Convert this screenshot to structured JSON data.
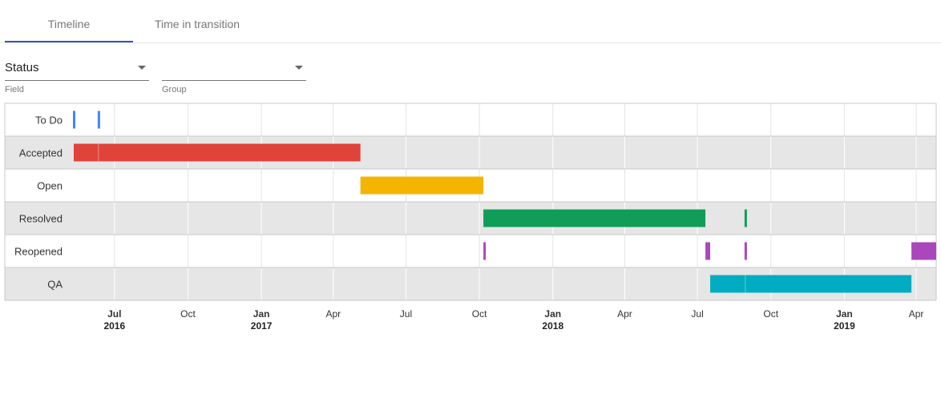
{
  "tabs": [
    {
      "label": "Timeline",
      "active": true
    },
    {
      "label": "Time in transition",
      "active": false
    }
  ],
  "filters": {
    "field": {
      "value": "Status",
      "label": "Field"
    },
    "group": {
      "value": "",
      "label": "Group"
    }
  },
  "colors": {
    "accent": "#3f51b5",
    "row_alt": "#e6e6e6",
    "grid": "#d9d9d9"
  },
  "chart_data": {
    "type": "timeline",
    "xlim": [
      "2016-05-09",
      "2019-04-26"
    ],
    "x_ticks": [
      {
        "date": "2016-07-01",
        "label": "Jul",
        "year": "2016"
      },
      {
        "date": "2016-10-01",
        "label": "Oct",
        "year": ""
      },
      {
        "date": "2017-01-01",
        "label": "Jan",
        "year": "2017"
      },
      {
        "date": "2017-04-01",
        "label": "Apr",
        "year": ""
      },
      {
        "date": "2017-07-01",
        "label": "Jul",
        "year": ""
      },
      {
        "date": "2017-10-01",
        "label": "Oct",
        "year": ""
      },
      {
        "date": "2018-01-01",
        "label": "Jan",
        "year": "2018"
      },
      {
        "date": "2018-04-01",
        "label": "Apr",
        "year": ""
      },
      {
        "date": "2018-07-01",
        "label": "Jul",
        "year": ""
      },
      {
        "date": "2018-10-01",
        "label": "Oct",
        "year": ""
      },
      {
        "date": "2019-01-01",
        "label": "Jan",
        "year": "2019"
      },
      {
        "date": "2019-04-01",
        "label": "Apr",
        "year": ""
      }
    ],
    "rows": [
      {
        "label": "To Do",
        "color": "#4285f4",
        "bars": [
          {
            "start": "2016-05-10",
            "end": "2016-05-12"
          },
          {
            "start": "2016-06-10",
            "end": "2016-06-12"
          }
        ]
      },
      {
        "label": "Accepted",
        "color": "#e0433a",
        "bars": [
          {
            "start": "2016-05-11",
            "end": "2016-06-11"
          },
          {
            "start": "2016-06-11",
            "end": "2017-05-05"
          }
        ]
      },
      {
        "label": "Open",
        "color": "#f4b400",
        "bars": [
          {
            "start": "2017-05-05",
            "end": "2017-10-06"
          }
        ]
      },
      {
        "label": "Resolved",
        "color": "#0f9d58",
        "bars": [
          {
            "start": "2017-10-06",
            "end": "2018-07-11"
          },
          {
            "start": "2018-08-29",
            "end": "2018-08-31"
          }
        ]
      },
      {
        "label": "Reopened",
        "color": "#ab47bc",
        "bars": [
          {
            "start": "2017-10-06",
            "end": "2017-10-08"
          },
          {
            "start": "2018-07-11",
            "end": "2018-07-17"
          },
          {
            "start": "2018-08-29",
            "end": "2018-08-31"
          },
          {
            "start": "2019-03-26",
            "end": "2019-04-26"
          }
        ]
      },
      {
        "label": "QA",
        "color": "#00acc1",
        "bars": [
          {
            "start": "2018-07-17",
            "end": "2018-08-30"
          },
          {
            "start": "2018-08-30",
            "end": "2019-03-26"
          }
        ]
      }
    ]
  }
}
